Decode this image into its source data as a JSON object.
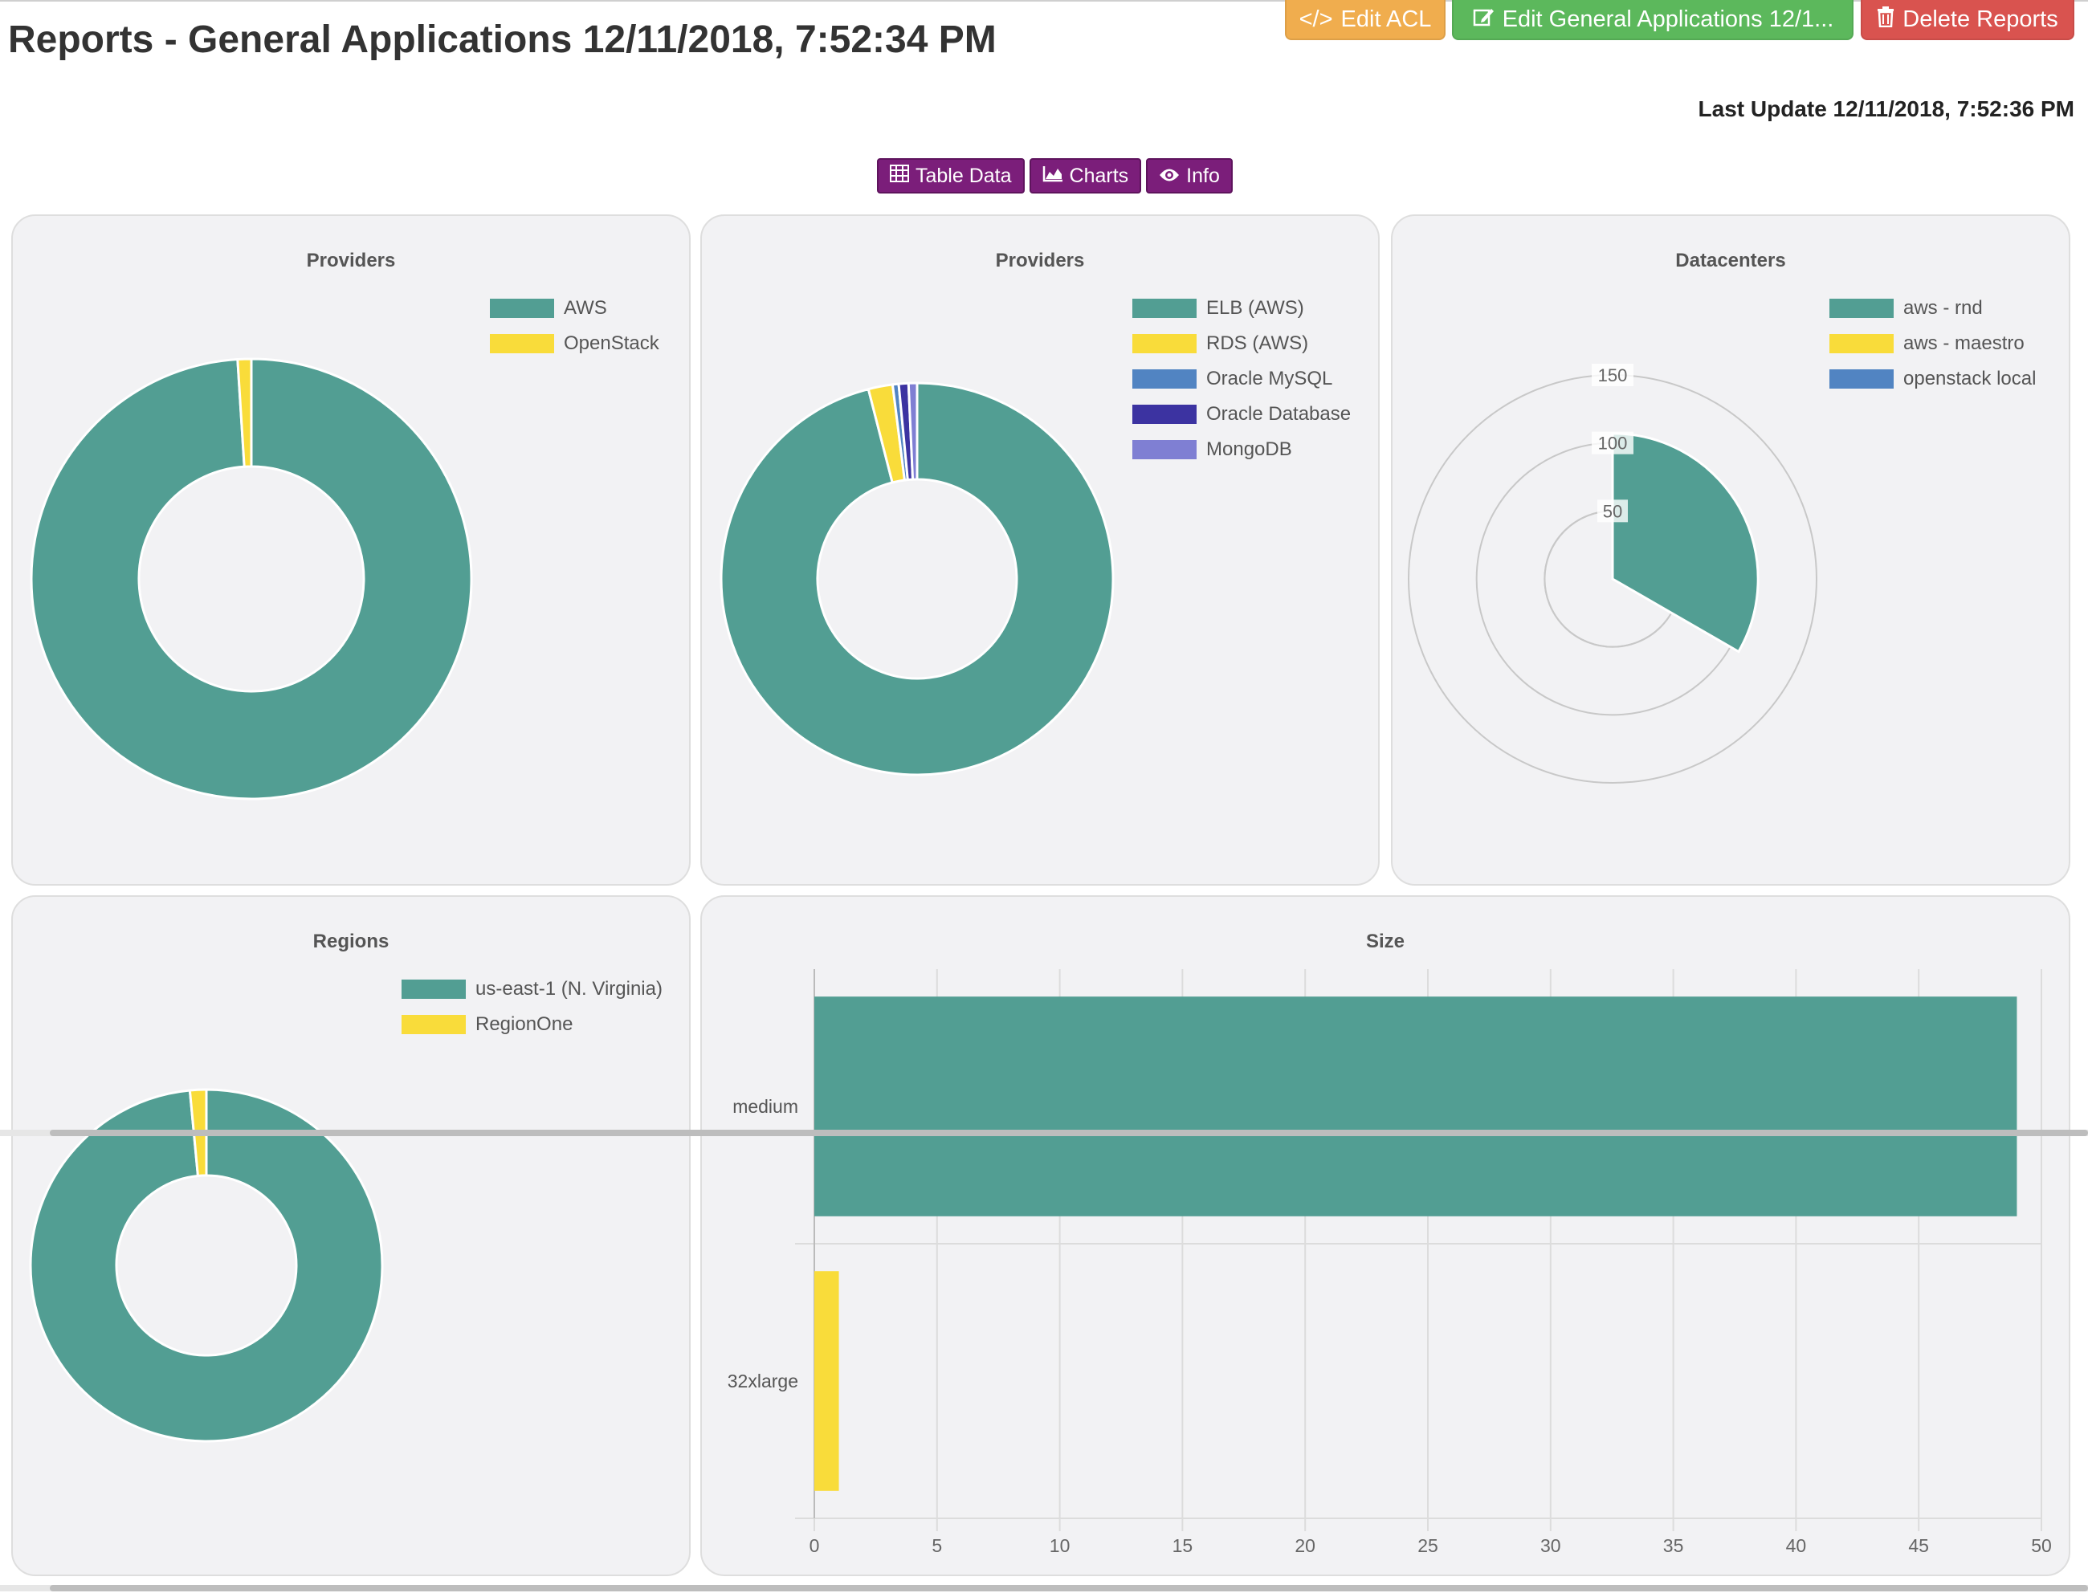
{
  "header": {
    "title": "Reports - General Applications 12/11/2018, 7:52:34 PM",
    "edit_acl_label": "Edit ACL",
    "edit_label": "Edit General Applications 12/1...",
    "delete_label": "Delete Reports",
    "last_update": "Last Update 12/11/2018, 7:52:36 PM"
  },
  "view_tabs": {
    "table_label": "Table Data",
    "charts_label": "Charts",
    "info_label": "Info"
  },
  "colors": {
    "teal": "#529e93",
    "yellow": "#f9dc3a",
    "blue": "#5184c2",
    "navy": "#3c33a1",
    "lavender": "#7f7fd3",
    "purple_button": "#7b1e7a",
    "acl_button": "#f0ad4e",
    "edit_button": "#5cb85c",
    "delete_button": "#d9534f"
  },
  "chart_data": [
    {
      "id": "providers1",
      "type": "pie",
      "variant": "doughnut",
      "title": "Providers",
      "categories": [
        "AWS",
        "OpenStack"
      ],
      "values": [
        99,
        1
      ],
      "colors": [
        "#529e93",
        "#f9dc3a"
      ],
      "legend": "top-right"
    },
    {
      "id": "providers2",
      "type": "pie",
      "variant": "doughnut",
      "title": "Providers",
      "categories": [
        "ELB (AWS)",
        "RDS (AWS)",
        "Oracle MySQL",
        "Oracle Database",
        "MongoDB"
      ],
      "values": [
        96,
        2,
        0.5,
        0.8,
        0.7
      ],
      "colors": [
        "#529e93",
        "#f9dc3a",
        "#5184c2",
        "#3c33a1",
        "#7f7fd3"
      ],
      "legend": "top-right"
    },
    {
      "id": "datacenters",
      "type": "polar-area",
      "title": "Datacenters",
      "categories": [
        "aws - rnd",
        "aws - maestro",
        "openstack local"
      ],
      "values": [
        107,
        0,
        0
      ],
      "colors": [
        "#529e93",
        "#f9dc3a",
        "#5184c2"
      ],
      "r_ticks": [
        "50",
        "100",
        "150"
      ],
      "r_max": 150,
      "legend": "top-right"
    },
    {
      "id": "regions",
      "type": "pie",
      "variant": "doughnut",
      "title": "Regions",
      "categories": [
        "us-east-1 (N. Virginia)",
        "RegionOne"
      ],
      "values": [
        98.5,
        1.5
      ],
      "colors": [
        "#529e93",
        "#f9dc3a"
      ],
      "legend": "top-right"
    },
    {
      "id": "size",
      "type": "bar",
      "orientation": "horizontal",
      "title": "Size",
      "categories": [
        "medium",
        "32xlarge"
      ],
      "values": [
        49,
        1
      ],
      "colors": [
        "#529e93",
        "#f9dc3a"
      ],
      "x_ticks": [
        "0",
        "5",
        "10",
        "15",
        "20",
        "25",
        "30",
        "35",
        "40",
        "45",
        "50"
      ],
      "xlim": [
        0,
        50
      ],
      "grid": true
    }
  ]
}
